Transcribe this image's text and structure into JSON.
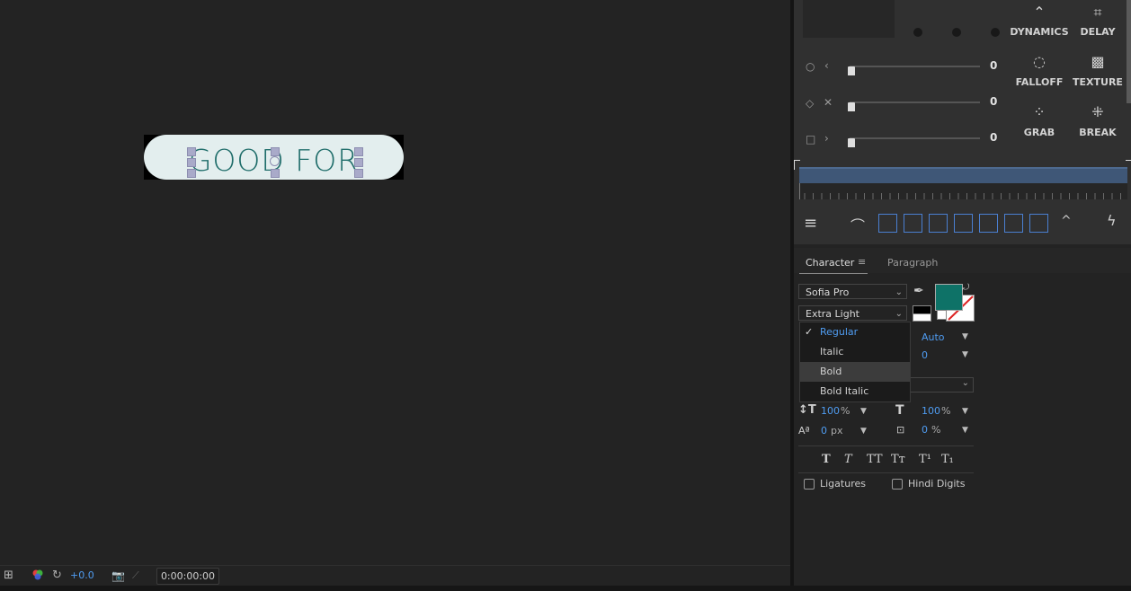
{
  "canvas": {
    "text_layer": "GOOD FOR",
    "pill_color": "#e3eeee",
    "text_color": "#1f6d6a"
  },
  "viewer_bar": {
    "exposure": "+0.0",
    "timecode": "0:00:00:00"
  },
  "tool_panel": {
    "sliders": [
      {
        "shape": "circle",
        "value": "0"
      },
      {
        "shape": "diamond",
        "value": "0"
      },
      {
        "shape": "square",
        "value": "0"
      }
    ],
    "buttons": [
      {
        "label": "DYNAMICS",
        "icon": "chevron-up-icon"
      },
      {
        "label": "DELAY",
        "icon": "crop-icon"
      },
      {
        "label": "FALLOFF",
        "icon": "dashed-circle-icon"
      },
      {
        "label": "TEXTURE",
        "icon": "hatched-square-icon"
      },
      {
        "label": "GRAB",
        "icon": "grid-icon"
      },
      {
        "label": "BREAK",
        "icon": "break-icon"
      }
    ]
  },
  "character_panel": {
    "tabs": [
      "Character",
      "Paragraph"
    ],
    "font_family": "Sofia Pro",
    "font_style": "Extra Light",
    "fill_color": "#0e7267",
    "style_menu": {
      "items": [
        "Regular",
        "Italic",
        "Bold",
        "Bold Italic"
      ],
      "checked": "Regular",
      "hovered": "Bold"
    },
    "leading": "Auto",
    "tracking": "0",
    "vertical_scale": "100",
    "vertical_scale_unit": "%",
    "horizontal_scale": "100",
    "horizontal_scale_unit": "%",
    "baseline_shift": "0",
    "baseline_shift_unit": "px",
    "tsume": "0",
    "tsume_unit": "%",
    "checkboxes": [
      "Ligatures",
      "Hindi Digits"
    ]
  }
}
